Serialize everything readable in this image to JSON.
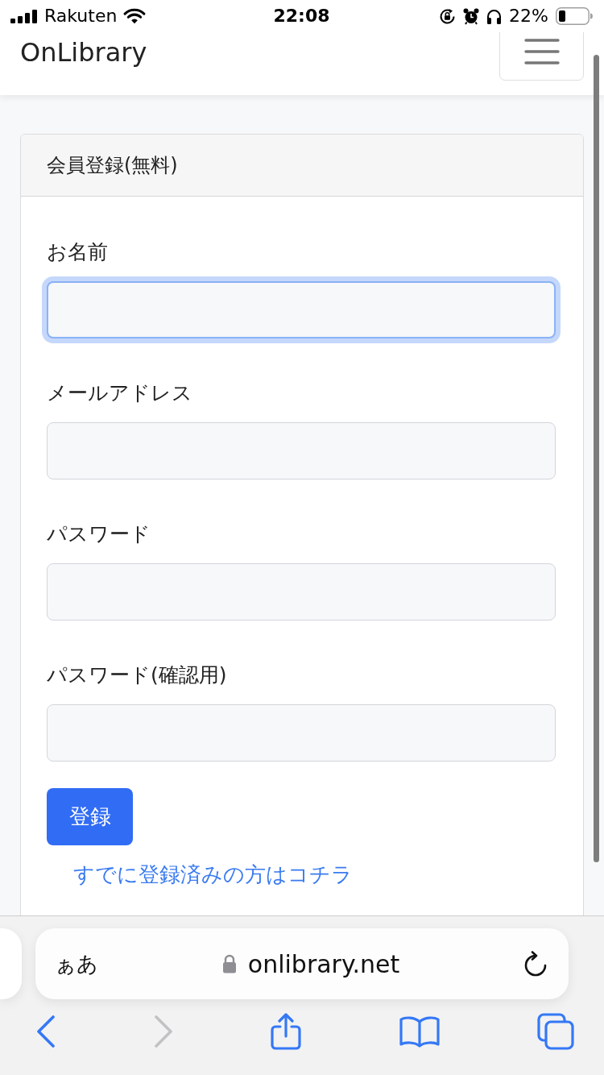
{
  "status_bar": {
    "carrier": "Rakuten",
    "time": "22:08",
    "battery": "22%"
  },
  "navbar": {
    "brand": "OnLibrary"
  },
  "card": {
    "title": "会員登録(無料)",
    "fields": [
      {
        "label": "お名前",
        "focused": true
      },
      {
        "label": "メールアドレス",
        "focused": false
      },
      {
        "label": "パスワード",
        "focused": false
      },
      {
        "label": "パスワード(確認用)",
        "focused": false
      }
    ],
    "submit": "登録",
    "login_link": "すでに登録済みの方はコチラ"
  },
  "browser": {
    "text_size": "ぁあ",
    "url": "onlibrary.net",
    "toolbar": [
      {
        "kind": "back",
        "disabled": false
      },
      {
        "kind": "forward",
        "disabled": true
      },
      {
        "kind": "share",
        "disabled": false
      },
      {
        "kind": "bookmarks",
        "disabled": false
      },
      {
        "kind": "tabs",
        "disabled": false
      }
    ]
  }
}
